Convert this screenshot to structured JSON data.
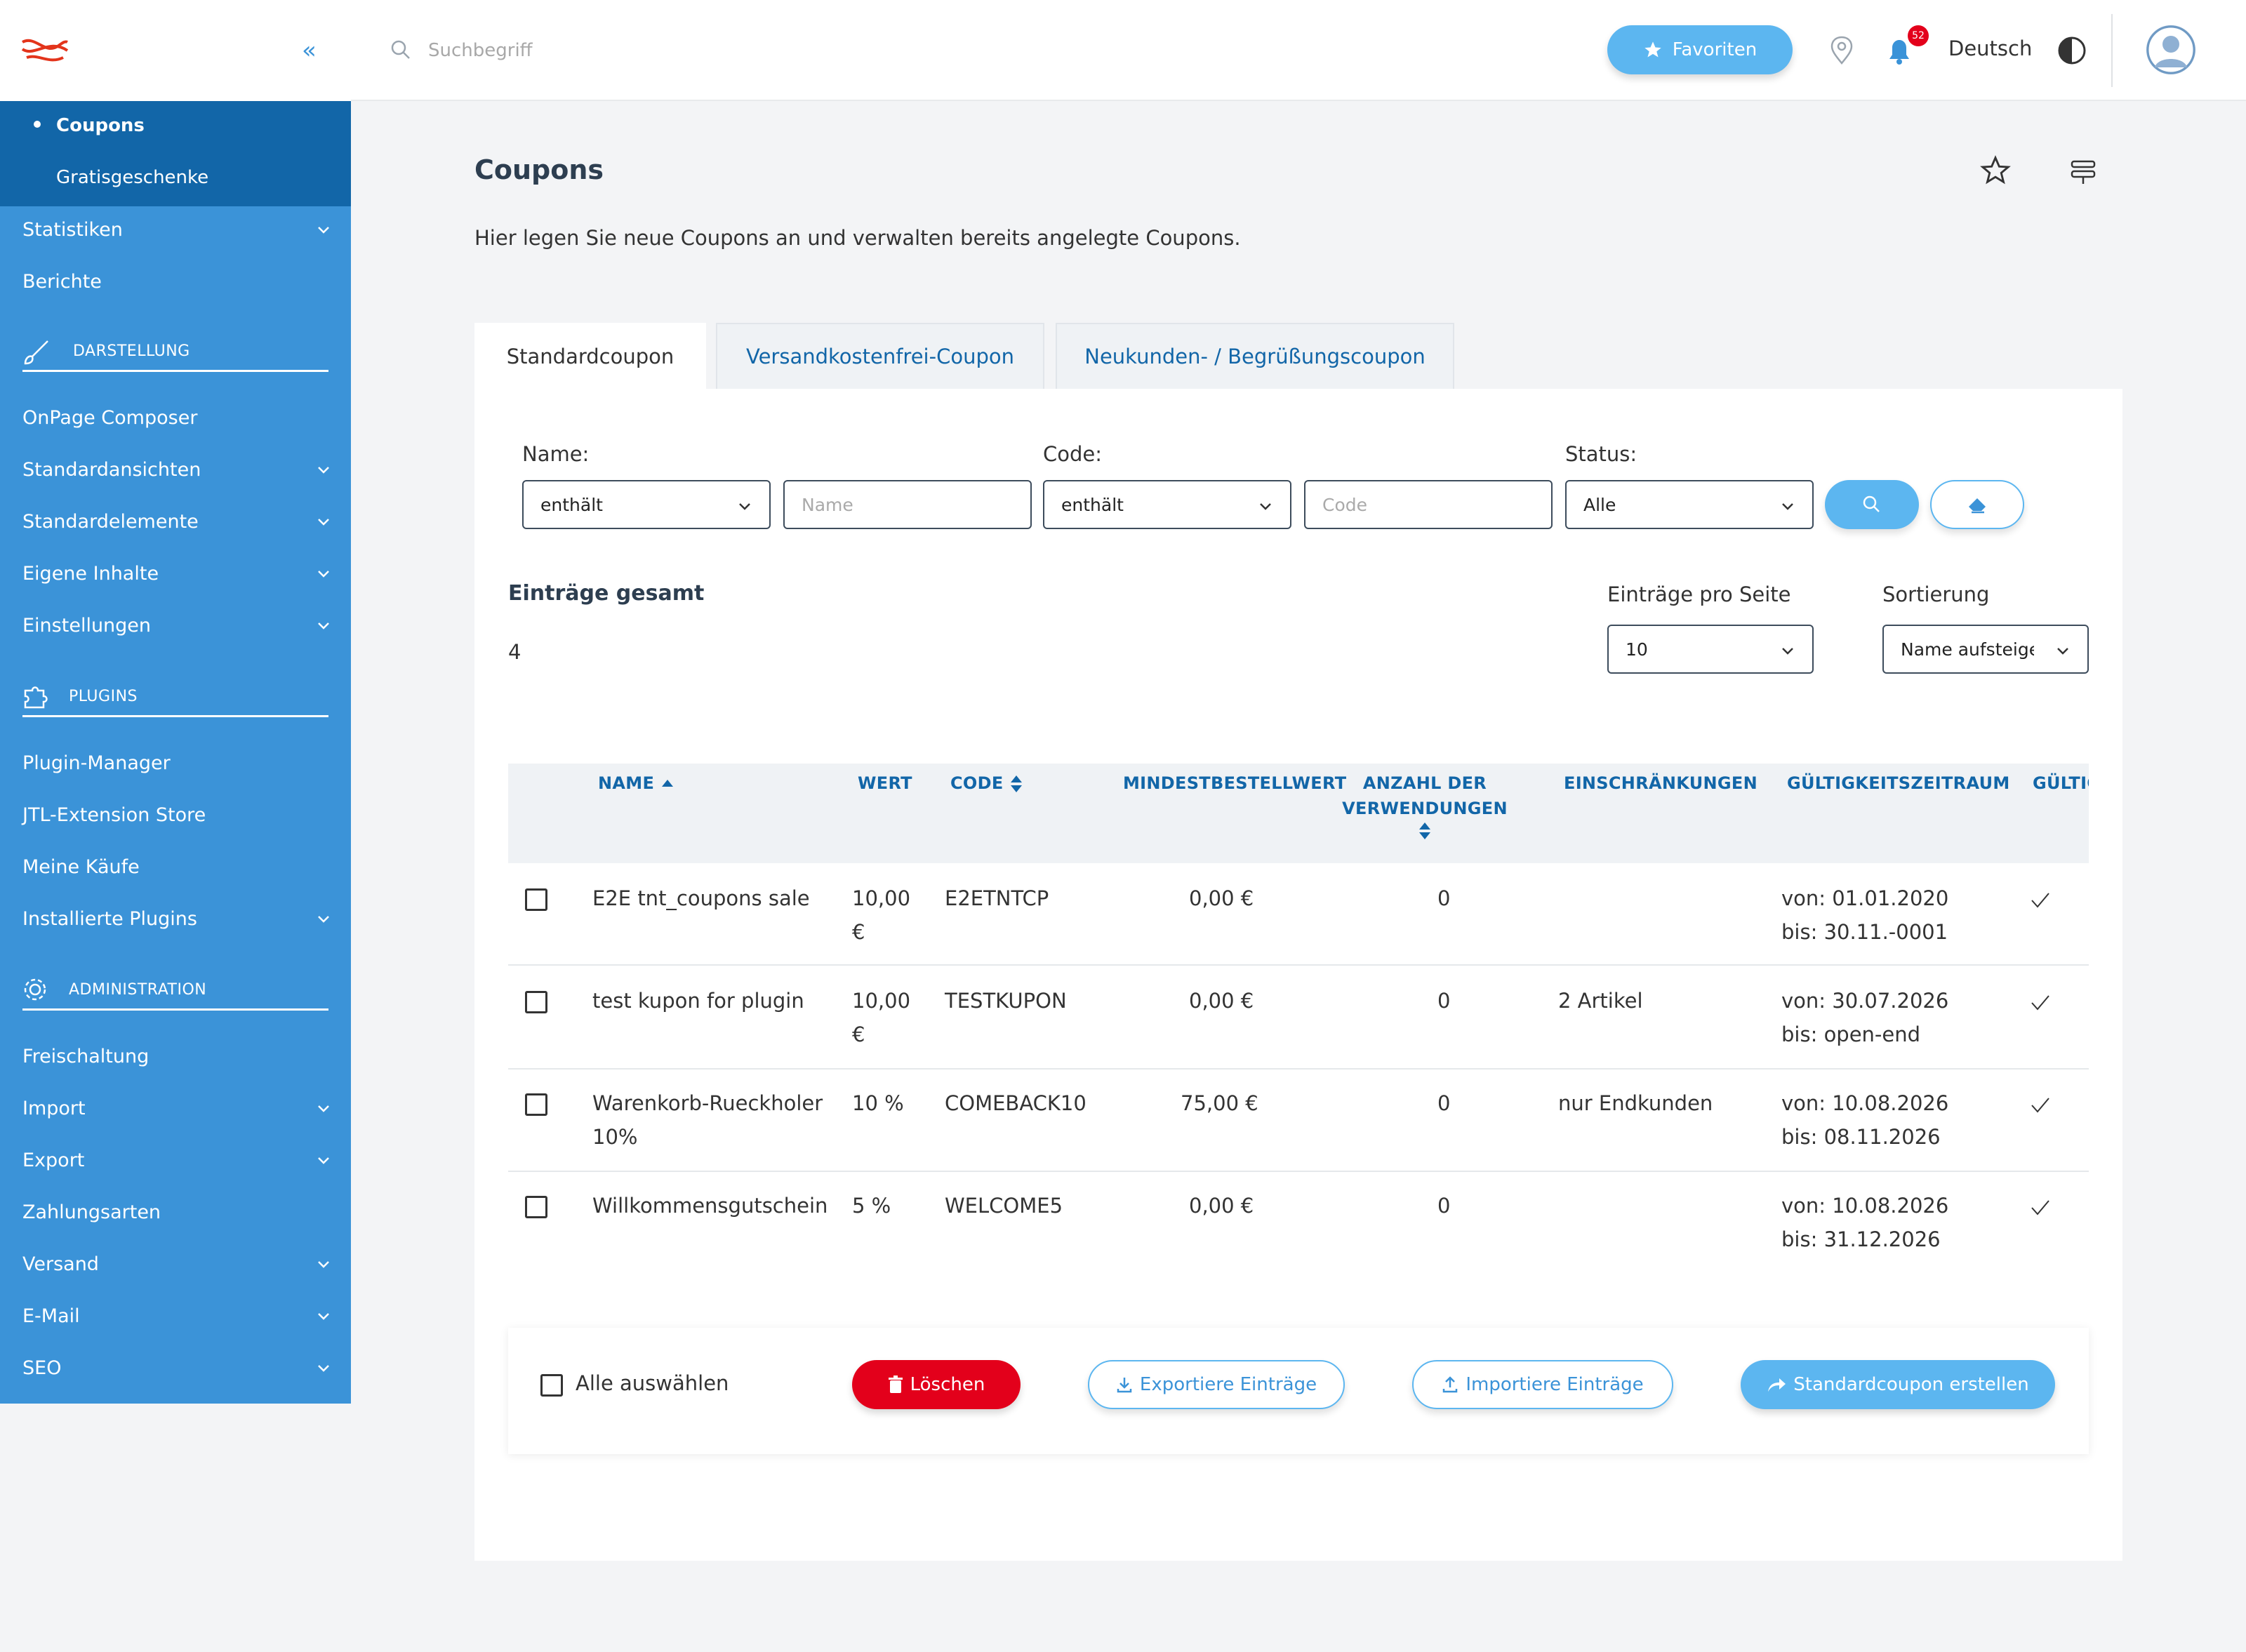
{
  "sidebar": {
    "sub_items": [
      {
        "label": "Coupons",
        "active": true
      },
      {
        "label": "Gratisgeschenke",
        "active": false
      }
    ],
    "items": [
      {
        "label": "Statistiken",
        "expandable": true
      },
      {
        "label": "Berichte",
        "expandable": false
      }
    ],
    "section_darstellung": "DARSTELLUNG",
    "darstellung_items": [
      {
        "label": "OnPage Composer",
        "expandable": false
      },
      {
        "label": "Standardansichten",
        "expandable": true
      },
      {
        "label": "Standardelemente",
        "expandable": true
      },
      {
        "label": "Eigene Inhalte",
        "expandable": true
      },
      {
        "label": "Einstellungen",
        "expandable": true
      }
    ],
    "section_plugins": "PLUGINS",
    "plugins_items": [
      {
        "label": "Plugin-Manager",
        "expandable": false
      },
      {
        "label": "JTL-Extension Store",
        "expandable": false
      },
      {
        "label": "Meine Käufe",
        "expandable": false
      },
      {
        "label": "Installierte Plugins",
        "expandable": true
      }
    ],
    "section_admin": "ADMINISTRATION",
    "admin_items": [
      {
        "label": "Freischaltung",
        "expandable": false
      },
      {
        "label": "Import",
        "expandable": true
      },
      {
        "label": "Export",
        "expandable": true
      },
      {
        "label": "Zahlungsarten",
        "expandable": false
      },
      {
        "label": "Versand",
        "expandable": true
      },
      {
        "label": "E-Mail",
        "expandable": true
      },
      {
        "label": "SEO",
        "expandable": true
      }
    ]
  },
  "topbar": {
    "search_placeholder": "Suchbegriff",
    "favorites_label": "Favoriten",
    "notification_count": "52",
    "language": "Deutsch"
  },
  "page": {
    "title": "Coupons",
    "description": "Hier legen Sie neue Coupons an und verwalten bereits angelegte Coupons."
  },
  "tabs": [
    {
      "label": "Standardcoupon",
      "active": true
    },
    {
      "label": "Versandkostenfrei-Coupon",
      "active": false
    },
    {
      "label": "Neukunden- / Begrüßungscoupon",
      "active": false
    }
  ],
  "filters": {
    "name_label": "Name:",
    "name_operator": "enthält",
    "name_placeholder": "Name",
    "code_label": "Code:",
    "code_operator": "enthält",
    "code_placeholder": "Code",
    "status_label": "Status:",
    "status_value": "Alle"
  },
  "summary": {
    "total_label": "Einträge gesamt",
    "total_value": "4",
    "per_page_label": "Einträge pro Seite",
    "per_page_value": "10",
    "sort_label": "Sortierung",
    "sort_value": "Name aufsteige"
  },
  "table": {
    "headers": {
      "name": "NAME",
      "value": "WERT",
      "code": "CODE",
      "min_order": "MINDESTBESTELLWERT",
      "uses_line1": "ANZAHL DER",
      "uses_line2": "VERWENDUNGEN",
      "restrictions": "EINSCHRÄNKUNGEN",
      "validity": "GÜLTIGKEITSZEITRAUM",
      "valid": "GÜLTIG"
    },
    "rows": [
      {
        "name_l1": "E2E tnt_coupons sale",
        "name_l2": "",
        "value_l1": "10,00",
        "value_l2": "€",
        "code": "E2ETNTCP",
        "min_order": "0,00 €",
        "uses": "0",
        "restrictions": "",
        "valid_from": "von: 01.01.2020",
        "valid_to": "bis: 30.11.-0001"
      },
      {
        "name_l1": "test kupon for plugin",
        "name_l2": "",
        "value_l1": "10,00",
        "value_l2": "€",
        "code": "TESTKUPON",
        "min_order": "0,00 €",
        "uses": "0",
        "restrictions": "2 Artikel",
        "valid_from": "von: 30.07.2026",
        "valid_to": "bis: open-end"
      },
      {
        "name_l1": "Warenkorb-Rueckholer",
        "name_l2": "10%",
        "value_l1": "10 %",
        "value_l2": "",
        "code": "COMEBACK10",
        "min_order": "75,00 €",
        "uses": "0",
        "restrictions": "nur Endkunden",
        "valid_from": "von: 10.08.2026",
        "valid_to": "bis: 08.11.2026"
      },
      {
        "name_l1": "Willkommensgutschein",
        "name_l2": "",
        "value_l1": "5 %",
        "value_l2": "",
        "code": "WELCOME5",
        "min_order": "0,00 €",
        "uses": "0",
        "restrictions": "",
        "valid_from": "von: 10.08.2026",
        "valid_to": "bis: 31.12.2026"
      }
    ]
  },
  "actions": {
    "select_all": "Alle auswählen",
    "delete": "Löschen",
    "export": "Exportiere Einträge",
    "import": "Importiere Einträge",
    "create": "Standardcoupon erstellen"
  },
  "colors": {
    "sidebar": "#3b93d8",
    "sidebar_active": "#1266a8",
    "accent": "#5cb6f0",
    "danger": "#e3001b"
  }
}
